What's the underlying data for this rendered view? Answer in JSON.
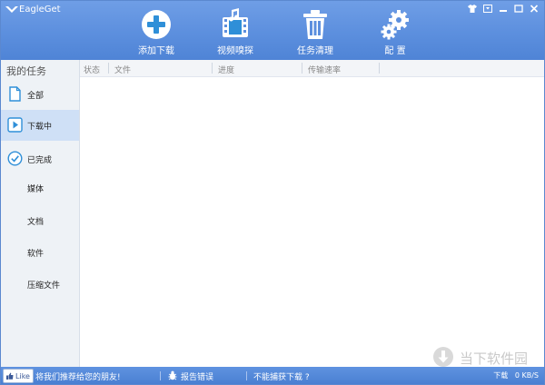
{
  "window": {
    "title": "EagleGet",
    "controls": [
      "shirt-icon",
      "settings-icon",
      "minimize-icon",
      "maximize-icon",
      "close-icon"
    ]
  },
  "toolbar": {
    "add": {
      "label": "添加下载",
      "icon": "plus-circle-icon"
    },
    "sniff": {
      "label": "视频嗅探",
      "icon": "film-music-icon"
    },
    "clean": {
      "label": "任务清理",
      "icon": "trash-icon"
    },
    "config": {
      "label": "配 置",
      "icon": "gears-icon"
    }
  },
  "sidebar": {
    "header": "我的任务",
    "items": [
      {
        "label": "全部",
        "icon": "document-icon"
      },
      {
        "label": "下载中",
        "icon": "play-icon",
        "active": true
      },
      {
        "label": "已完成",
        "icon": "check-circle-icon"
      }
    ],
    "subitems": [
      {
        "label": "媒体"
      },
      {
        "label": "文档"
      },
      {
        "label": "软件"
      },
      {
        "label": "压缩文件"
      }
    ]
  },
  "columns": [
    "状态",
    "文件",
    "进度",
    "传输速率"
  ],
  "watermark": {
    "text": "当下软件园",
    "icon": "download-arrow-icon"
  },
  "statusbar": {
    "like": "Like",
    "recommend": "将我们推荐给您的朋友!",
    "report": "报告错误",
    "cannot_capture": "不能捕获下载 ?",
    "speed_label": "下载",
    "speed_value": "0 KB/S"
  },
  "colors": {
    "accent": "#5c8fde",
    "sidebar_bg": "#eef2f6",
    "active_bg": "#cfe0f6",
    "icon_blue": "#2f8fd8"
  }
}
